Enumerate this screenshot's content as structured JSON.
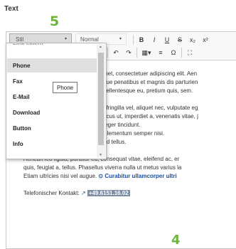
{
  "field": {
    "label": "Text"
  },
  "markers": {
    "m5": "5",
    "m4": "4"
  },
  "toolbar": {
    "style_combo": {
      "value": "Stil",
      "arrow": "▾"
    },
    "format_combo": {
      "value": "Normal",
      "arrow": "▾"
    },
    "row1_buttons": [
      {
        "name": "bold",
        "glyph": "B"
      },
      {
        "name": "italic",
        "glyph": "I"
      },
      {
        "name": "underline",
        "glyph": "U"
      },
      {
        "name": "strikethrough",
        "glyph": "S"
      },
      {
        "name": "subscript",
        "glyph": "x₂"
      },
      {
        "name": "superscript",
        "glyph": "x²"
      }
    ],
    "row2_buttons": [
      {
        "name": "clear-format",
        "glyph": "Tx"
      },
      {
        "name": "undo",
        "glyph": "↶"
      },
      {
        "name": "redo",
        "glyph": "↷"
      },
      {
        "name": "table",
        "glyph": "▦▾"
      },
      {
        "name": "horizontal-line",
        "glyph": "≡"
      },
      {
        "name": "special-char",
        "glyph": "Ω"
      },
      {
        "name": "maximize",
        "glyph": "⛶"
      }
    ]
  },
  "dropdown": {
    "cut_item": "Link extern",
    "items": [
      "Phone",
      "Fax",
      "E-Mail",
      "Download",
      "Button",
      "Info"
    ],
    "selected": "Phone",
    "tooltip": "Phone"
  },
  "content": {
    "line1": "met, consectetuer adipiscing elit. Aen",
    "line2": "que penatibus et magnis dis parturien",
    "line3": "pellentesque eu, pretium quis, sem.",
    "line4": ", fringilla vel, aliquet nec, vulputate eg",
    "line5": "ncus ut, imperdiet a, venenatis vitae, j",
    "line6": "teger tincidunt.",
    "bullet1": "Cras dapibus. Vivamus elementum semper nisi.",
    "bullet2": "Aenean vulputate eleifend tellus.",
    "para1": "Aenean leo ligula, porttitor eu, consequat vitae, eleifend ac, er",
    "para2": "quis, feugiat a, tellus. Phasellus viverra nulla ut metus varius la",
    "para3": "Etiam ultricies nisi vel augue.",
    "para3_link": "Curabitur ullamcorper ultri",
    "contact_label": "Telefonischer Kontakt:",
    "contact_phone": "+49.6151.16.02"
  },
  "colors": {
    "marker": "#6cb33f",
    "link": "#1a4e9e",
    "phone_highlight": "#7f8ea5"
  }
}
